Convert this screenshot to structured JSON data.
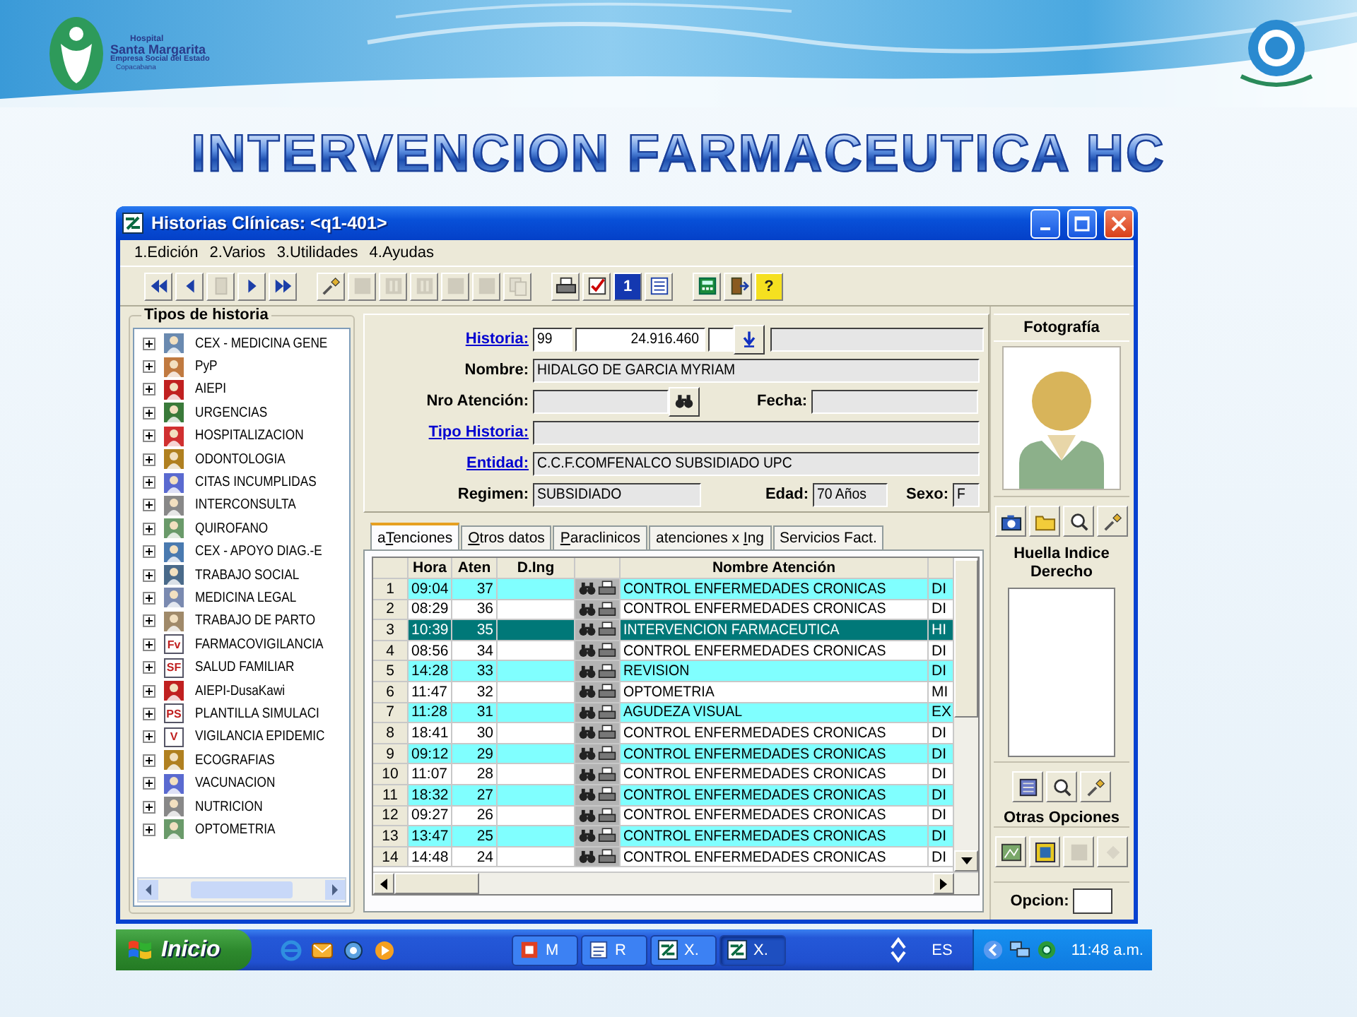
{
  "banner": {
    "logo_text": [
      "Hospital",
      "Santa Margarita",
      "Empresa Social del Estado",
      "Copacabana"
    ],
    "title": "INTERVENCION FARMACEUTICA HC"
  },
  "window": {
    "title": "Historias Clínicas: <q1-401>",
    "menu": [
      "1.Edición",
      "2.Varios",
      "3.Utilidades",
      "4.Ayudas"
    ],
    "toolbar": [
      [
        {
          "kind": "rewind",
          "disabled": false
        },
        {
          "kind": "prev",
          "disabled": false
        },
        {
          "kind": "record",
          "disabled": true
        },
        {
          "kind": "next",
          "disabled": false
        },
        {
          "kind": "ffwd",
          "disabled": false
        }
      ],
      [
        {
          "kind": "brush",
          "disabled": false
        },
        {
          "kind": "square",
          "disabled": true
        },
        {
          "kind": "layout",
          "disabled": true
        },
        {
          "kind": "layout",
          "disabled": true
        },
        {
          "kind": "square",
          "disabled": true
        },
        {
          "kind": "square",
          "disabled": true
        },
        {
          "kind": "pages",
          "disabled": true
        }
      ],
      [
        {
          "kind": "printer",
          "disabled": false
        },
        {
          "kind": "checkbox",
          "disabled": false
        },
        {
          "kind": "card",
          "disabled": false,
          "glyph": "1"
        },
        {
          "kind": "list",
          "disabled": false
        }
      ],
      [
        {
          "kind": "calculator",
          "disabled": false
        },
        {
          "kind": "door",
          "disabled": false
        },
        {
          "kind": "help",
          "disabled": false,
          "glyph": "?"
        }
      ]
    ]
  },
  "tree": {
    "title": "Tipos de historia",
    "items": [
      {
        "label": "CEX - MEDICINA GENE",
        "expanded": false
      },
      {
        "label": "PyP",
        "expanded": false
      },
      {
        "label": "AIEPI",
        "expanded": false
      },
      {
        "label": "URGENCIAS",
        "expanded": false
      },
      {
        "label": "HOSPITALIZACION",
        "expanded": false
      },
      {
        "label": "ODONTOLOGIA",
        "expanded": false
      },
      {
        "label": "CITAS INCUMPLIDAS",
        "expanded": false
      },
      {
        "label": "INTERCONSULTA",
        "expanded": false
      },
      {
        "label": "QUIROFANO",
        "expanded": false
      },
      {
        "label": "CEX - APOYO DIAG.-E",
        "expanded": false
      },
      {
        "label": "TRABAJO SOCIAL",
        "expanded": false
      },
      {
        "label": "MEDICINA LEGAL",
        "expanded": false
      },
      {
        "label": "TRABAJO DE PARTO",
        "expanded": false
      },
      {
        "label": "FARMACOVIGILANCIA",
        "expanded": false,
        "badge": "Fv"
      },
      {
        "label": "SALUD FAMILIAR",
        "expanded": false,
        "badge": "SF"
      },
      {
        "label": "AIEPI-DusaKawi",
        "expanded": false
      },
      {
        "label": "PLANTILLA SIMULACI",
        "expanded": false,
        "badge": "PS"
      },
      {
        "label": "VIGILANCIA EPIDEMIC",
        "expanded": false,
        "badge": "V"
      },
      {
        "label": "ECOGRAFIAS",
        "expanded": false
      },
      {
        "label": "VACUNACION",
        "expanded": false
      },
      {
        "label": "NUTRICION",
        "expanded": false
      },
      {
        "label": "OPTOMETRIA",
        "expanded": false
      }
    ]
  },
  "form": {
    "historia": {
      "label": "Historia:",
      "link": true,
      "number": "99",
      "document": "24.916.460"
    },
    "nombre": {
      "label": "Nombre:",
      "link": false,
      "value": "HIDALGO DE GARCIA MYRIAM"
    },
    "nro_atencion": {
      "label": "Nro Atención:",
      "link": false
    },
    "fecha": {
      "label": "Fecha:",
      "link": false
    },
    "tipo_historia": {
      "label": "Tipo Historia:",
      "link": true
    },
    "entidad": {
      "label": "Entidad:",
      "link": true,
      "value": "C.C.F.COMFENALCO SUBSIDIADO UPC"
    },
    "regimen": {
      "label": "Regimen:",
      "link": false,
      "value": "SUBSIDIADO"
    },
    "edad": {
      "label": "Edad:",
      "link": false,
      "value": "70 Años"
    },
    "sexo": {
      "label": "Sexo:",
      "link": false,
      "value": "F"
    }
  },
  "tabs": [
    {
      "label_parts": [
        {
          "text": "a",
          "underline": false
        },
        {
          "text": "T",
          "underline": true
        },
        {
          "text": "enciones",
          "underline": false
        }
      ],
      "selected": true
    },
    {
      "label_parts": [
        {
          "text": "O",
          "underline": true
        },
        {
          "text": "tros datos",
          "underline": false
        }
      ],
      "selected": false
    },
    {
      "label_parts": [
        {
          "text": "P",
          "underline": true
        },
        {
          "text": "araclinicos",
          "underline": false
        }
      ],
      "selected": false
    },
    {
      "label_parts": [
        {
          "text": "atenciones x ",
          "underline": false
        },
        {
          "text": "I",
          "underline": true
        },
        {
          "text": "ng",
          "underline": false
        }
      ],
      "selected": false
    },
    {
      "label_parts": [
        {
          "text": "Servicios Fact.",
          "underline": false
        }
      ],
      "selected": false
    }
  ],
  "table": {
    "columns": [
      "Hora",
      "Aten",
      "D.Ing",
      "Nombre Atención"
    ],
    "rows": [
      {
        "number": "1",
        "hora": "09:04",
        "aten": "37",
        "nombre_atencion": "CONTROL ENFERMEDADES CRONICAS",
        "column_7": "DI",
        "selected": false
      },
      {
        "number": "2",
        "hora": "08:29",
        "aten": "36",
        "nombre_atencion": "CONTROL ENFERMEDADES CRONICAS",
        "column_7": "DI",
        "selected": false
      },
      {
        "number": "3",
        "hora": "10:39",
        "aten": "35",
        "nombre_atencion": "INTERVENCION FARMACEUTICA",
        "column_7": "HI",
        "selected": true
      },
      {
        "number": "4",
        "hora": "08:56",
        "aten": "34",
        "nombre_atencion": "CONTROL ENFERMEDADES CRONICAS",
        "column_7": "DI",
        "selected": false
      },
      {
        "number": "5",
        "hora": "14:28",
        "aten": "33",
        "nombre_atencion": "REVISION",
        "column_7": "DI",
        "selected": false
      },
      {
        "number": "6",
        "hora": "11:47",
        "aten": "32",
        "nombre_atencion": "OPTOMETRIA",
        "column_7": "MI",
        "selected": false
      },
      {
        "number": "7",
        "hora": "11:28",
        "aten": "31",
        "nombre_atencion": "AGUDEZA VISUAL",
        "column_7": "EX",
        "selected": false
      },
      {
        "number": "8",
        "hora": "18:41",
        "aten": "30",
        "nombre_atencion": "CONTROL ENFERMEDADES CRONICAS",
        "column_7": "DI",
        "selected": false
      },
      {
        "number": "9",
        "hora": "09:12",
        "aten": "29",
        "nombre_atencion": "CONTROL ENFERMEDADES CRONICAS",
        "column_7": "DI",
        "selected": false
      },
      {
        "number": "10",
        "hora": "11:07",
        "aten": "28",
        "nombre_atencion": "CONTROL ENFERMEDADES CRONICAS",
        "column_7": "DI",
        "selected": false
      },
      {
        "number": "11",
        "hora": "18:32",
        "aten": "27",
        "nombre_atencion": "CONTROL ENFERMEDADES CRONICAS",
        "column_7": "DI",
        "selected": false
      },
      {
        "number": "12",
        "hora": "09:27",
        "aten": "26",
        "nombre_atencion": "CONTROL ENFERMEDADES CRONICAS",
        "column_7": "DI",
        "selected": false
      },
      {
        "number": "13",
        "hora": "13:47",
        "aten": "25",
        "nombre_atencion": "CONTROL ENFERMEDADES CRONICAS",
        "column_7": "DI",
        "selected": false
      },
      {
        "number": "14",
        "hora": "14:48",
        "aten": "24",
        "nombre_atencion": "CONTROL ENFERMEDADES CRONICAS",
        "column_7": "DI",
        "selected": false
      }
    ]
  },
  "side": {
    "photo_title": "Fotografía",
    "photo_tools": [
      {
        "kind": "camera",
        "disabled": false
      },
      {
        "kind": "folder",
        "disabled": false
      },
      {
        "kind": "magnifier",
        "disabled": false
      },
      {
        "kind": "brush",
        "disabled": false
      }
    ],
    "fingerprint_title": "Huella Indice Derecho",
    "fingerprint_tools": [
      {
        "kind": "scanner",
        "disabled": false
      },
      {
        "kind": "magnifier",
        "disabled": false
      },
      {
        "kind": "brush",
        "disabled": false
      }
    ],
    "other_title": "Otras Opciones",
    "other_tools": [
      {
        "kind": "map",
        "disabled": false
      },
      {
        "kind": "frame",
        "disabled": false
      },
      {
        "kind": "square",
        "disabled": true
      },
      {
        "kind": "diamond",
        "disabled": true
      }
    ],
    "option_label": "Opcion:"
  },
  "taskbar": {
    "start": "Inicio",
    "quick_launch": [
      {
        "kind": "globe"
      },
      {
        "kind": "mail"
      },
      {
        "kind": "gear"
      },
      {
        "kind": "play"
      }
    ],
    "tasks": [
      {
        "label": "M",
        "kind": "document",
        "selected": false
      },
      {
        "label": "R",
        "kind": "window",
        "selected": false
      },
      {
        "label": "X.",
        "kind": "app",
        "selected": false
      },
      {
        "label": "X.",
        "kind": "app",
        "selected": true
      }
    ],
    "language": "ES",
    "clock": "11:48 a.m."
  }
}
